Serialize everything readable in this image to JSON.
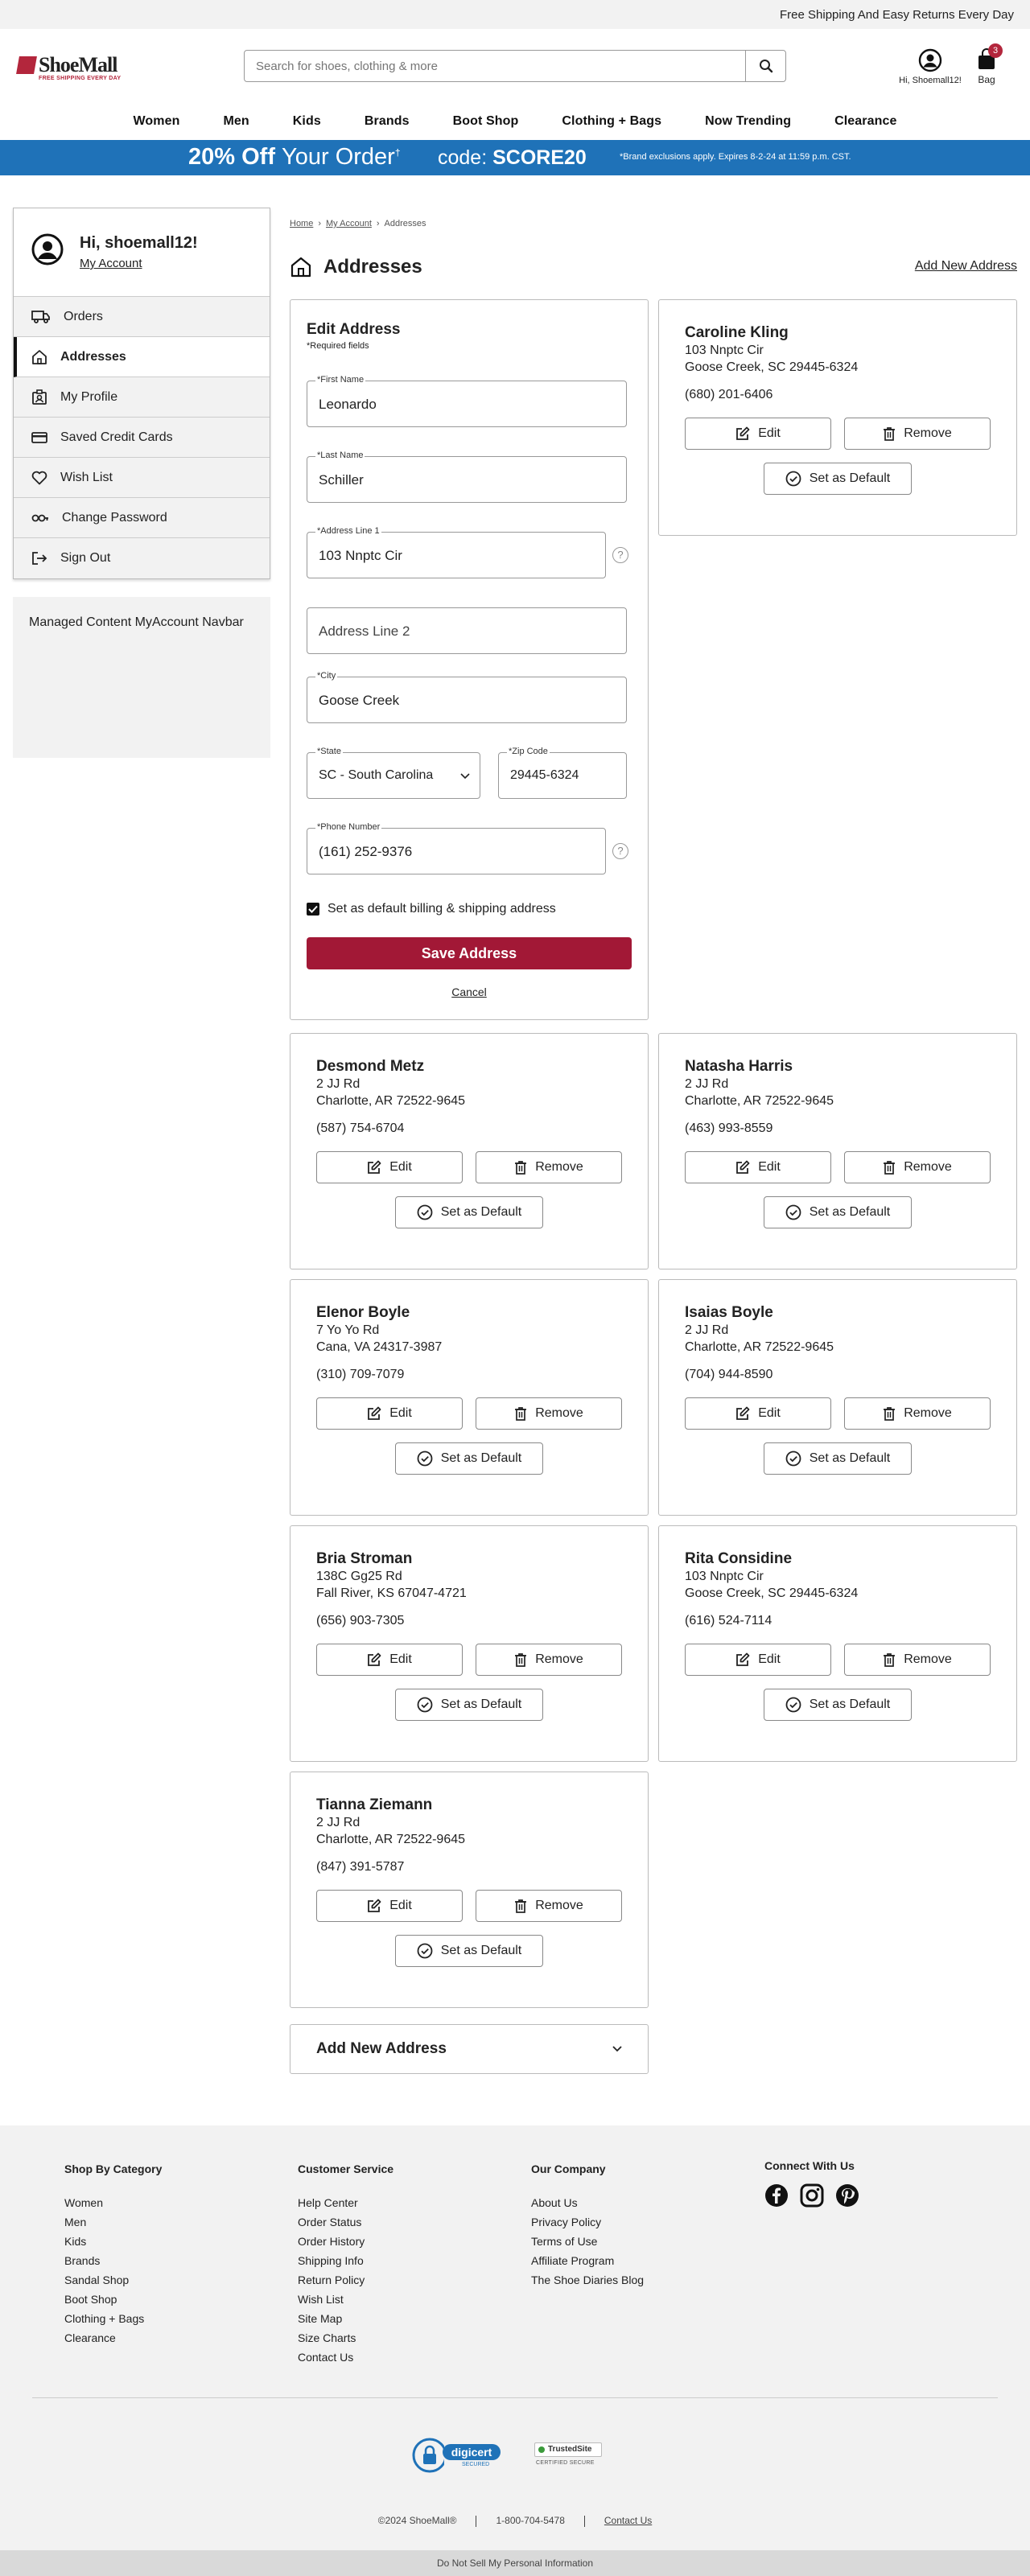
{
  "topbar": {
    "text": "Free Shipping And Easy Returns Every Day"
  },
  "header": {
    "logo_text": "ShoeMall",
    "logo_tagline": "FREE SHIPPING EVERY DAY",
    "search_placeholder": "Search for shoes, clothing & more",
    "account_label": "Hi, Shoemall12!",
    "bag_label": "Bag",
    "bag_count": "3"
  },
  "nav": [
    "Women",
    "Men",
    "Kids",
    "Brands",
    "Boot Shop",
    "Clothing + Bags",
    "Now Trending",
    "Clearance"
  ],
  "promo": {
    "big": "20% Off",
    "your": "Your Order",
    "sup": "†",
    "code_label": "code:",
    "code": "SCORE20",
    "fine": "*Brand exclusions apply. Expires 8-2-24 at 11:59 p.m. CST."
  },
  "sidebar": {
    "greeting": "Hi, shoemall12!",
    "my_account": "My Account",
    "items": [
      "Orders",
      "Addresses",
      "My Profile",
      "Saved Credit Cards",
      "Wish List",
      "Change Password",
      "Sign Out"
    ],
    "managed": "Managed Content MyAccount Navbar"
  },
  "breadcrumb": {
    "home": "Home",
    "account": "My Account",
    "current": "Addresses"
  },
  "page": {
    "title": "Addresses",
    "add_new": "Add New Address"
  },
  "edit_form": {
    "title": "Edit Address",
    "required": "*Required fields",
    "first_name_label": "*First Name",
    "first_name": "Leonardo",
    "last_name_label": "*Last Name",
    "last_name": "Schiller",
    "address1_label": "*Address Line 1",
    "address1": "103 Nnptc Cir",
    "address2_placeholder": "Address Line 2",
    "city_label": "*City",
    "city": "Goose Creek",
    "state_label": "*State",
    "state": "SC - South Carolina",
    "zip_label": "*Zip Code",
    "zip": "29445-6324",
    "phone_label": "*Phone Number",
    "phone": "(161) 252-9376",
    "default_label": "Set as default billing & shipping address",
    "save": "Save Address",
    "cancel": "Cancel"
  },
  "buttons": {
    "edit": "Edit",
    "remove": "Remove",
    "default": "Set as Default"
  },
  "addresses": [
    {
      "name": "Caroline Kling",
      "line1": "103 Nnptc Cir",
      "line2": "Goose Creek, SC 29445-6324",
      "phone": "(680) 201-6406"
    },
    {
      "name": "Desmond Metz",
      "line1": "2 JJ Rd",
      "line2": "Charlotte, AR 72522-9645",
      "phone": "(587) 754-6704"
    },
    {
      "name": "Natasha Harris",
      "line1": "2 JJ Rd",
      "line2": "Charlotte, AR 72522-9645",
      "phone": "(463) 993-8559"
    },
    {
      "name": "Elenor Boyle",
      "line1": "7 Yo Yo Rd",
      "line2": "Cana, VA 24317-3987",
      "phone": "(310) 709-7079"
    },
    {
      "name": "Isaias Boyle",
      "line1": "2 JJ Rd",
      "line2": "Charlotte, AR 72522-9645",
      "phone": "(704) 944-8590"
    },
    {
      "name": "Bria Stroman",
      "line1": "138C Gg25 Rd",
      "line2": "Fall River, KS 67047-4721",
      "phone": "(656) 903-7305"
    },
    {
      "name": "Rita Considine",
      "line1": "103 Nnptc Cir",
      "line2": "Goose Creek, SC 29445-6324",
      "phone": "(616) 524-7114"
    },
    {
      "name": "Tianna Ziemann",
      "line1": "2 JJ Rd",
      "line2": "Charlotte, AR 72522-9645",
      "phone": "(847) 391-5787"
    }
  ],
  "add_new_bar": "Add New Address",
  "footer": {
    "shop_title": "Shop By Category",
    "shop": [
      "Women",
      "Men",
      "Kids",
      "Brands",
      "Sandal Shop",
      "Boot Shop",
      "Clothing + Bags",
      "Clearance"
    ],
    "service_title": "Customer Service",
    "service": [
      "Help Center",
      "Order Status",
      "Order History",
      "Shipping Info",
      "Return Policy",
      "Wish List",
      "Site Map",
      "Size Charts",
      "Contact Us"
    ],
    "company_title": "Our Company",
    "company": [
      "About Us",
      "Privacy Policy",
      "Terms of Use",
      "Affiliate Program",
      "The Shoe Diaries Blog"
    ],
    "connect_title": "Connect With Us",
    "digicert": "digicert",
    "digicert_sub": "SECURED",
    "trustedsite": "TrustedSite",
    "trustedsite_sub": "CERTIFIED SECURE",
    "copyright": "©2024 ShoeMall®",
    "phone": "1-800-704-5478",
    "contact": "Contact Us",
    "dnsm": "Do Not Sell My Personal Information"
  },
  "colors": {
    "brand": "#a21836",
    "promo": "#1f72b8"
  }
}
